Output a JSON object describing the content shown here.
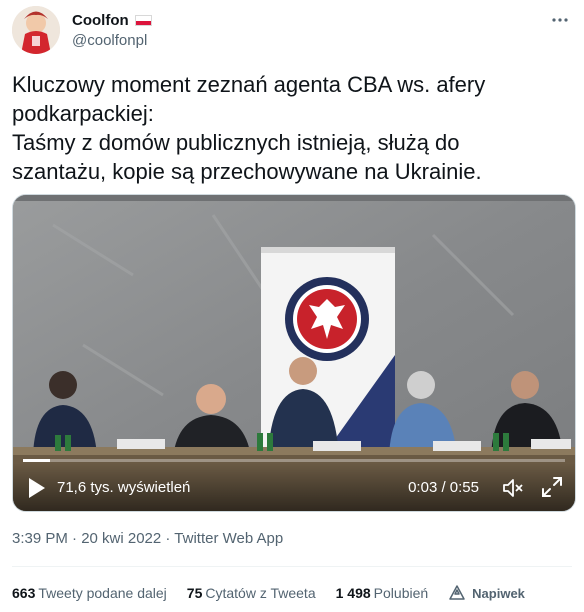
{
  "author": {
    "display_name": "Coolfon",
    "handle": "@coolfonpl",
    "flag_icon": "poland-flag-icon",
    "more_icon": "more-options-icon"
  },
  "tweet": {
    "lines": [
      "Kluczowy moment zeznań agenta CBA ws. afery",
      "podkarpackiej:",
      "Taśmy z domów publicznych istnieją, służą do",
      "szantażu, kopie są przechowywane na Ukrainie."
    ]
  },
  "video": {
    "views": "71,6 tys. wyświetleń",
    "time": "0:03 / 0:55",
    "progress_fraction": 0.05,
    "play_icon": "play-icon",
    "volume_icon": "volume-icon",
    "fullscreen_icon": "fullscreen-icon"
  },
  "meta": {
    "timestamp": "3:39 PM · 20 kwi 2022 · Twitter Web App"
  },
  "stats": {
    "retweets_count": "663",
    "retweets_label": "Tweety podane dalej",
    "quotes_count": "75",
    "quotes_label": "Cytatów z Tweeta",
    "likes_count": "1 498",
    "likes_label": "Polubień",
    "tip_label": "Napiwek",
    "tip_icon": "tip-jar-icon"
  },
  "colors": {
    "text_primary": "#0f1419",
    "text_secondary": "#536471",
    "flag_red": "#dc143c"
  }
}
